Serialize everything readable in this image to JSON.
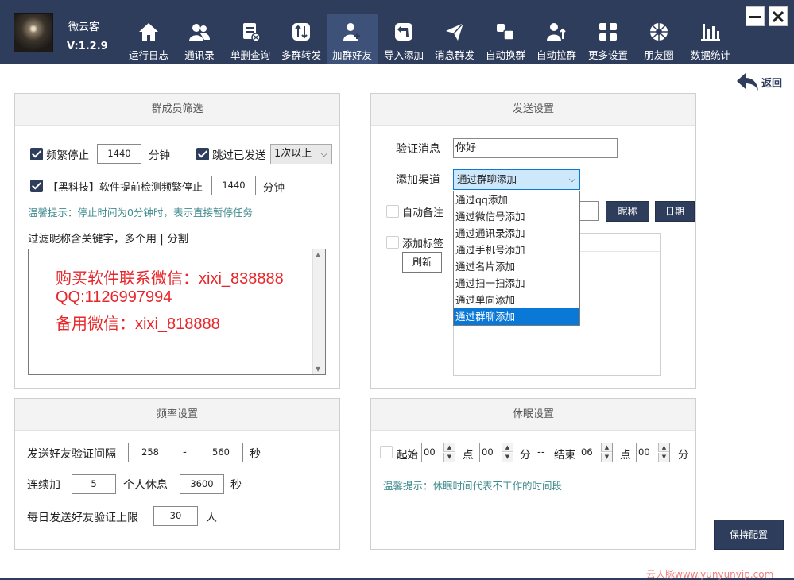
{
  "app": {
    "name": "微云客",
    "version": "V:1.2.9"
  },
  "nav": [
    {
      "label": "运行日志",
      "icon": "home-icon"
    },
    {
      "label": "通讯录",
      "icon": "contacts-icon"
    },
    {
      "label": "单删查询",
      "icon": "delete-check-icon"
    },
    {
      "label": "多群转发",
      "icon": "forward-icon"
    },
    {
      "label": "加群好友",
      "icon": "add-friend-icon",
      "active": true
    },
    {
      "label": "导入添加",
      "icon": "import-icon"
    },
    {
      "label": "消息群发",
      "icon": "send-icon"
    },
    {
      "label": "自动换群",
      "icon": "switch-group-icon"
    },
    {
      "label": "自动拉群",
      "icon": "pull-group-icon"
    },
    {
      "label": "更多设置",
      "icon": "grid-icon"
    },
    {
      "label": "朋友圈",
      "icon": "moments-icon"
    },
    {
      "label": "数据统计",
      "icon": "stats-icon"
    }
  ],
  "window": {
    "back_label": "返回"
  },
  "filter": {
    "title": "群成员筛选",
    "freq_stop_label": "频繁停止",
    "freq_stop_value": "1440",
    "minutes_unit": "分钟",
    "skip_sent_label": "跳过已发送",
    "skip_sent_option": "1次以上",
    "detect_label": "【黑科技】软件提前检测频繁停止",
    "detect_value": "1440",
    "detect_unit": "分钟",
    "hint": "温馨提示：停止时间为0分钟时，表示直接暂停任务",
    "keyword_label": "过滤昵称含关键字，多个用 | 分割",
    "keyword_lines": [
      "购买软件联系微信：xixi_838888",
      "QQ:1126997994",
      "备用微信：xixi_818888"
    ]
  },
  "send": {
    "title": "发送设置",
    "verify_label": "验证消息",
    "verify_value": "你好",
    "channel_label": "添加渠道",
    "channel_selected": "通过群聊添加",
    "channel_options": [
      "通过qq添加",
      "通过微信号添加",
      "通过通讯录添加",
      "通过手机号添加",
      "通过名片添加",
      "通过扫一扫添加",
      "通过单向添加",
      "通过群聊添加"
    ],
    "auto_remark_label": "自动备注",
    "nickname_button": "昵称",
    "date_button": "日期",
    "add_tag_label": "添加标签",
    "refresh_button": "刷新"
  },
  "rate": {
    "title": "频率设置",
    "interval_label": "发送好友验证间隔",
    "interval_min": "258",
    "interval_dash": "-",
    "interval_max": "560",
    "sec_unit": "秒",
    "continuous_label": "连续加",
    "continuous_value": "5",
    "rest_label": "个人休息",
    "rest_value": "3600",
    "rest_unit": "秒",
    "daily_label": "每日发送好友验证上限",
    "daily_value": "30",
    "daily_unit": "人"
  },
  "sleep": {
    "title": "休眠设置",
    "start_label": "起始",
    "start_hour": "00",
    "hour_unit": "点",
    "start_min": "00",
    "min_unit": "分",
    "sep": "--",
    "end_label": "结束",
    "end_hour": "06",
    "end_min": "00",
    "hint": "温馨提示：休眠时间代表不工作的时间段"
  },
  "save_button": "保持配置",
  "watermark": "云人脉www.yunyunvip.com"
}
